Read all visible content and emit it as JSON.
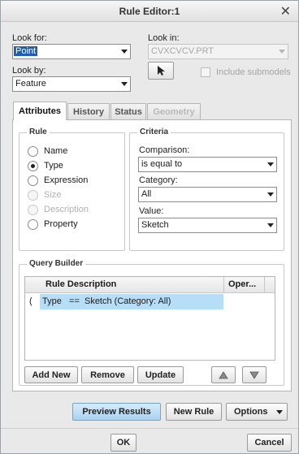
{
  "window": {
    "title": "Rule Editor:1"
  },
  "look_for": {
    "label": "Look for:",
    "value": "Point"
  },
  "look_in": {
    "label": "Look in:",
    "value": "CVXCVCV.PRT"
  },
  "look_by": {
    "label": "Look by:",
    "value": "Feature"
  },
  "include_submodels": {
    "label": "Include submodels",
    "checked": false
  },
  "tabs": [
    {
      "label": "Attributes",
      "state": "active"
    },
    {
      "label": "History",
      "state": "normal"
    },
    {
      "label": "Status",
      "state": "normal"
    },
    {
      "label": "Geometry",
      "state": "disabled"
    }
  ],
  "rule": {
    "title": "Rule",
    "options": [
      {
        "label": "Name",
        "selected": false,
        "enabled": true
      },
      {
        "label": "Type",
        "selected": true,
        "enabled": true
      },
      {
        "label": "Expression",
        "selected": false,
        "enabled": true
      },
      {
        "label": "Size",
        "selected": false,
        "enabled": false
      },
      {
        "label": "Description",
        "selected": false,
        "enabled": false
      },
      {
        "label": "Property",
        "selected": false,
        "enabled": true
      }
    ]
  },
  "criteria": {
    "title": "Criteria",
    "comparison": {
      "label": "Comparison:",
      "value": "is equal to"
    },
    "category": {
      "label": "Category:",
      "value": "All"
    },
    "value": {
      "label": "Value:",
      "value": "Sketch"
    }
  },
  "query_builder": {
    "title": "Query Builder",
    "columns": [
      "Rule Description",
      "Oper..."
    ],
    "rows": [
      {
        "paren": "(",
        "description": "Type   ==  Sketch (Category: All)",
        "operator": ""
      }
    ],
    "buttons": {
      "add_new": "Add New",
      "remove": "Remove",
      "update": "Update"
    }
  },
  "footer": {
    "preview_results": "Preview Results",
    "new_rule": "New Rule",
    "options": "Options",
    "ok": "OK",
    "cancel": "Cancel"
  },
  "icons": [
    "close-icon",
    "pointer-icon",
    "dropdown-arrow-icon",
    "move-up-icon",
    "move-down-icon"
  ]
}
